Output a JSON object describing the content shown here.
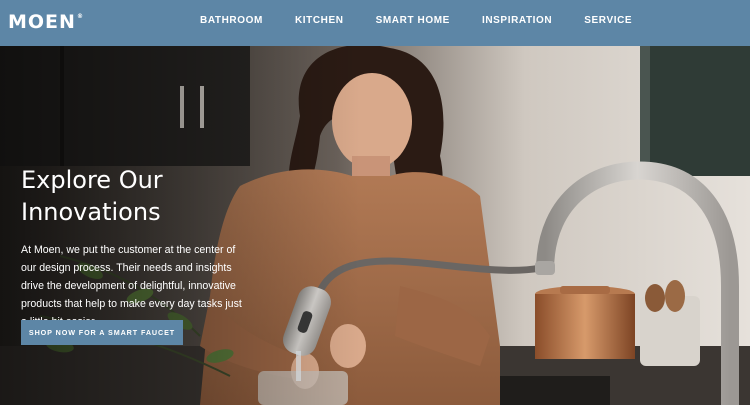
{
  "brand": {
    "logo_text": "MOEN",
    "logo_mark": "®"
  },
  "nav": {
    "items": [
      {
        "label": "BATHROOM"
      },
      {
        "label": "KITCHEN"
      },
      {
        "label": "SMART HOME"
      },
      {
        "label": "INSPIRATION"
      },
      {
        "label": "SERVICE"
      }
    ]
  },
  "hero": {
    "title": "Explore Our Innovations",
    "body": "At Moen, we put the customer at the center of our design process. Their needs and insights drive the development of delightful, innovative products that help to make every day tasks just a little bit easier.",
    "cta_label": "SHOP NOW FOR A SMART FAUCET"
  },
  "colors": {
    "header_bg": "#5d86a6",
    "cta_bg": "#5d86a6",
    "text": "#ffffff"
  }
}
